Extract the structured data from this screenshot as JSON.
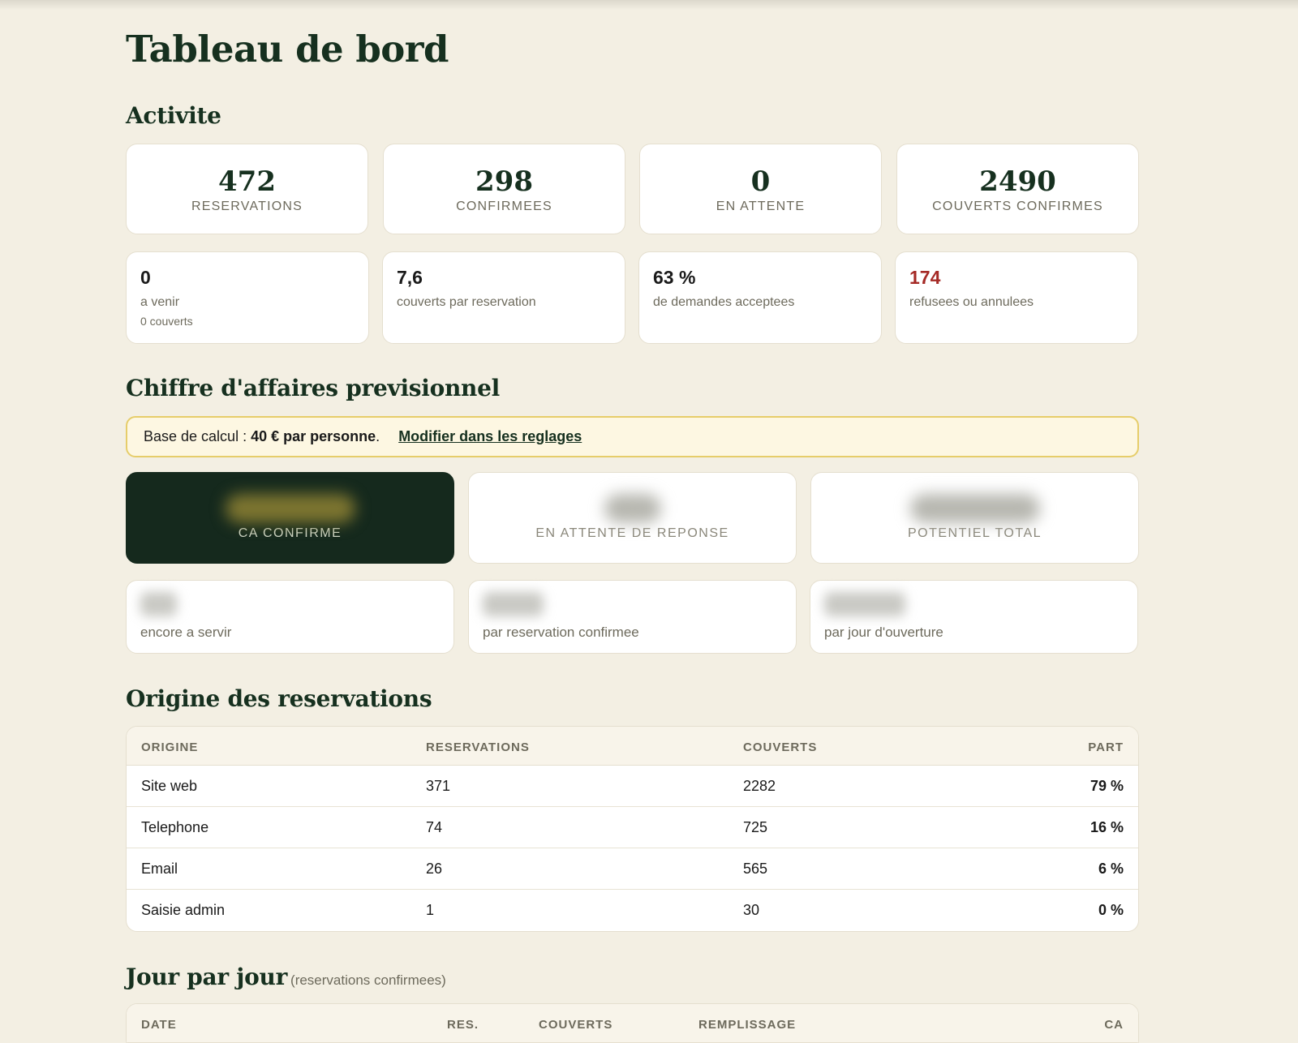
{
  "page_title": "Tableau de bord",
  "activite": {
    "title": "Activite",
    "kpis": [
      {
        "value": "472",
        "label": "RESERVATIONS"
      },
      {
        "value": "298",
        "label": "CONFIRMEES"
      },
      {
        "value": "0",
        "label": "EN ATTENTE"
      },
      {
        "value": "2490",
        "label": "COUVERTS CONFIRMES"
      }
    ],
    "stats": [
      {
        "value": "0",
        "desc": "a venir",
        "sub": "0 couverts"
      },
      {
        "value": "7,6",
        "desc": "couverts par reservation"
      },
      {
        "value": "63 %",
        "desc": "de demandes acceptees"
      },
      {
        "value": "174",
        "desc": "refusees ou annulees"
      }
    ]
  },
  "ca": {
    "title": "Chiffre d'affaires previsionnel",
    "notice_prefix": "Base de calcul : ",
    "notice_value": "40 € par personne",
    "notice_suffix": ".",
    "notice_link": "Modifier dans les reglages",
    "cards": [
      {
        "label": "CA CONFIRME"
      },
      {
        "label": "EN ATTENTE DE REPONSE"
      },
      {
        "label": "POTENTIEL TOTAL"
      }
    ],
    "subs": [
      {
        "desc": "encore a servir"
      },
      {
        "desc": "par reservation confirmee"
      },
      {
        "desc": "par jour d'ouverture"
      }
    ]
  },
  "origine": {
    "title": "Origine des reservations",
    "headers": [
      "ORIGINE",
      "RESERVATIONS",
      "COUVERTS",
      "PART"
    ],
    "rows": [
      {
        "origine": "Site web",
        "reservations": "371",
        "couverts": "2282",
        "part": "79 %"
      },
      {
        "origine": "Telephone",
        "reservations": "74",
        "couverts": "725",
        "part": "16 %"
      },
      {
        "origine": "Email",
        "reservations": "26",
        "couverts": "565",
        "part": "6 %"
      },
      {
        "origine": "Saisie admin",
        "reservations": "1",
        "couverts": "30",
        "part": "0 %"
      }
    ]
  },
  "jour": {
    "title": "Jour par jour",
    "note": "(reservations confirmees)",
    "headers": [
      "DATE",
      "RES.",
      "COUVERTS",
      "REMPLISSAGE",
      "CA"
    ]
  }
}
